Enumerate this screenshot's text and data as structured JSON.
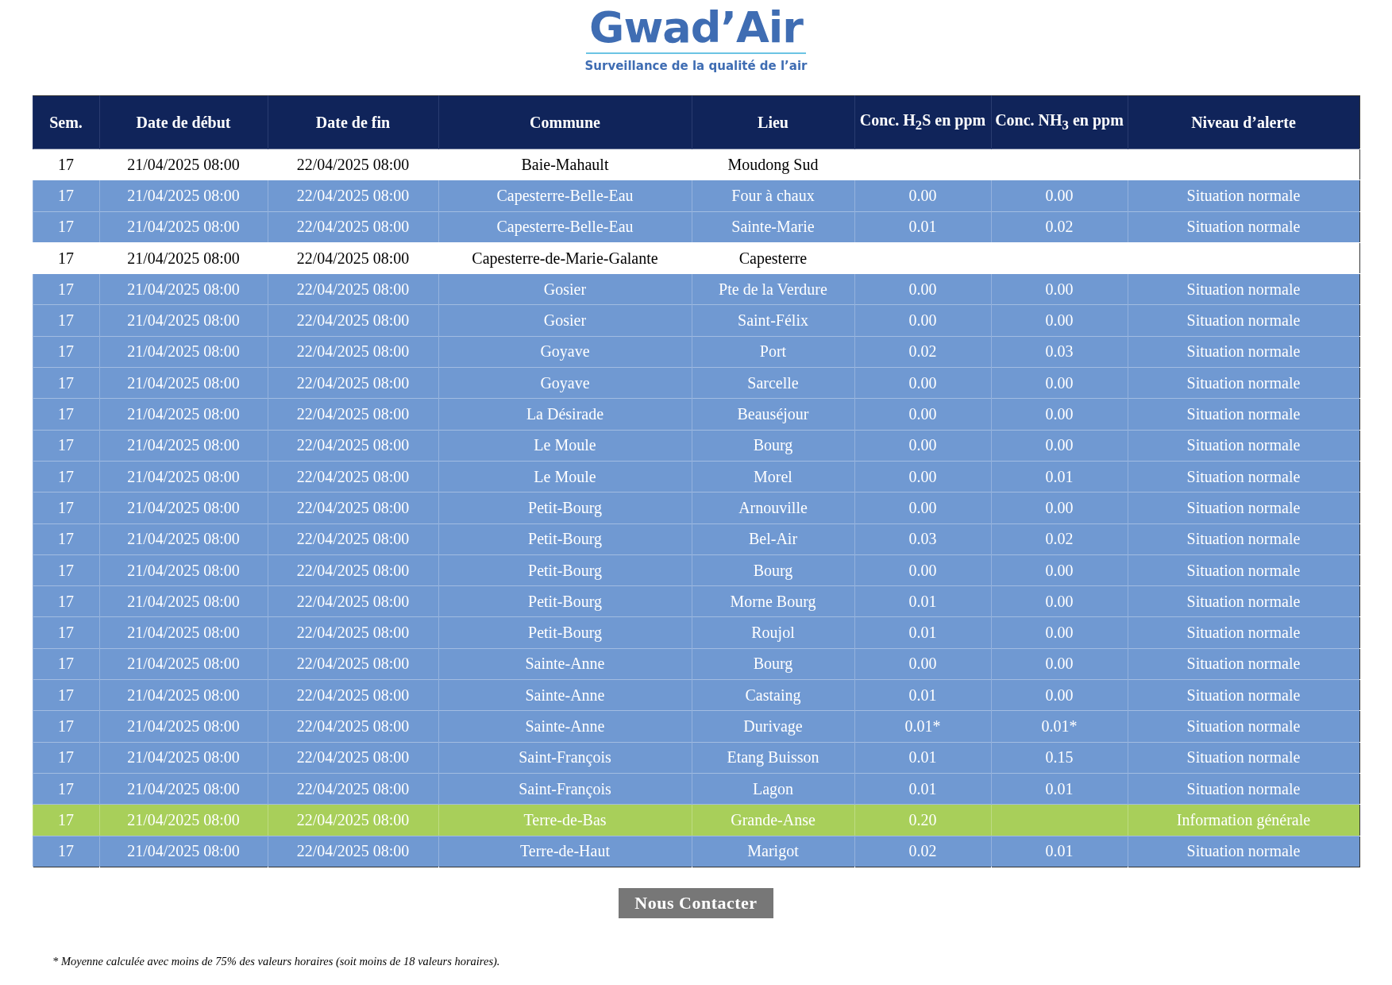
{
  "logo": {
    "name": "Gwad’Air",
    "tagline": "Surveillance de la qualité de l’air"
  },
  "table": {
    "columns": [
      "Sem.",
      "Date de début",
      "Date de fin",
      "Commune",
      "Lieu",
      "Conc. H$_{2}$S en ppm",
      "Conc. NH$_{3}$ en ppm",
      "Niveau d’alerte"
    ],
    "rows": [
      {
        "kind": "blank",
        "color": "#ffffff",
        "cells": [
          "17",
          "21/04/2025 08:00",
          "22/04/2025 08:00",
          "Baie-Mahault",
          "Moudong Sud",
          "",
          "",
          ""
        ]
      },
      {
        "kind": "normal",
        "color": "#7099d2",
        "cells": [
          "17",
          "21/04/2025 08:00",
          "22/04/2025 08:00",
          "Capesterre-Belle-Eau",
          "Four à chaux",
          "0.00",
          "0.00",
          "Situation normale"
        ]
      },
      {
        "kind": "normal",
        "color": "#7099d2",
        "cells": [
          "17",
          "21/04/2025 08:00",
          "22/04/2025 08:00",
          "Capesterre-Belle-Eau",
          "Sainte-Marie",
          "0.01",
          "0.02",
          "Situation normale"
        ]
      },
      {
        "kind": "blank",
        "color": "#ffffff",
        "cells": [
          "17",
          "21/04/2025 08:00",
          "22/04/2025 08:00",
          "Capesterre-de-Marie-Galante",
          "Capesterre",
          "",
          "",
          ""
        ]
      },
      {
        "kind": "normal",
        "color": "#7099d2",
        "cells": [
          "17",
          "21/04/2025 08:00",
          "22/04/2025 08:00",
          "Gosier",
          "Pte de la Verdure",
          "0.00",
          "0.00",
          "Situation normale"
        ]
      },
      {
        "kind": "normal",
        "color": "#7099d2",
        "cells": [
          "17",
          "21/04/2025 08:00",
          "22/04/2025 08:00",
          "Gosier",
          "Saint-Félix",
          "0.00",
          "0.00",
          "Situation normale"
        ]
      },
      {
        "kind": "normal",
        "color": "#7099d2",
        "cells": [
          "17",
          "21/04/2025 08:00",
          "22/04/2025 08:00",
          "Goyave",
          "Port",
          "0.02",
          "0.03",
          "Situation normale"
        ]
      },
      {
        "kind": "normal",
        "color": "#7099d2",
        "cells": [
          "17",
          "21/04/2025 08:00",
          "22/04/2025 08:00",
          "Goyave",
          "Sarcelle",
          "0.00",
          "0.00",
          "Situation normale"
        ]
      },
      {
        "kind": "normal",
        "color": "#7099d2",
        "cells": [
          "17",
          "21/04/2025 08:00",
          "22/04/2025 08:00",
          "La Désirade",
          "Beauséjour",
          "0.00",
          "0.00",
          "Situation normale"
        ]
      },
      {
        "kind": "normal",
        "color": "#7099d2",
        "cells": [
          "17",
          "21/04/2025 08:00",
          "22/04/2025 08:00",
          "Le Moule",
          "Bourg",
          "0.00",
          "0.00",
          "Situation normale"
        ]
      },
      {
        "kind": "normal",
        "color": "#7099d2",
        "cells": [
          "17",
          "21/04/2025 08:00",
          "22/04/2025 08:00",
          "Le Moule",
          "Morel",
          "0.00",
          "0.01",
          "Situation normale"
        ]
      },
      {
        "kind": "normal",
        "color": "#7099d2",
        "cells": [
          "17",
          "21/04/2025 08:00",
          "22/04/2025 08:00",
          "Petit-Bourg",
          "Arnouville",
          "0.00",
          "0.00",
          "Situation normale"
        ]
      },
      {
        "kind": "normal",
        "color": "#7099d2",
        "cells": [
          "17",
          "21/04/2025 08:00",
          "22/04/2025 08:00",
          "Petit-Bourg",
          "Bel-Air",
          "0.03",
          "0.02",
          "Situation normale"
        ]
      },
      {
        "kind": "normal",
        "color": "#7099d2",
        "cells": [
          "17",
          "21/04/2025 08:00",
          "22/04/2025 08:00",
          "Petit-Bourg",
          "Bourg",
          "0.00",
          "0.00",
          "Situation normale"
        ]
      },
      {
        "kind": "normal",
        "color": "#7099d2",
        "cells": [
          "17",
          "21/04/2025 08:00",
          "22/04/2025 08:00",
          "Petit-Bourg",
          "Morne Bourg",
          "0.01",
          "0.00",
          "Situation normale"
        ]
      },
      {
        "kind": "normal",
        "color": "#7099d2",
        "cells": [
          "17",
          "21/04/2025 08:00",
          "22/04/2025 08:00",
          "Petit-Bourg",
          "Roujol",
          "0.01",
          "0.00",
          "Situation normale"
        ]
      },
      {
        "kind": "normal",
        "color": "#7099d2",
        "cells": [
          "17",
          "21/04/2025 08:00",
          "22/04/2025 08:00",
          "Sainte-Anne",
          "Bourg",
          "0.00",
          "0.00",
          "Situation normale"
        ]
      },
      {
        "kind": "normal",
        "color": "#7099d2",
        "cells": [
          "17",
          "21/04/2025 08:00",
          "22/04/2025 08:00",
          "Sainte-Anne",
          "Castaing",
          "0.01",
          "0.00",
          "Situation normale"
        ]
      },
      {
        "kind": "normal",
        "color": "#7099d2",
        "cells": [
          "17",
          "21/04/2025 08:00",
          "22/04/2025 08:00",
          "Sainte-Anne",
          "Durivage",
          "0.01*",
          "0.01*",
          "Situation normale"
        ]
      },
      {
        "kind": "normal",
        "color": "#7099d2",
        "cells": [
          "17",
          "21/04/2025 08:00",
          "22/04/2025 08:00",
          "Saint-François",
          "Etang Buisson",
          "0.01",
          "0.15",
          "Situation normale"
        ]
      },
      {
        "kind": "normal",
        "color": "#7099d2",
        "cells": [
          "17",
          "21/04/2025 08:00",
          "22/04/2025 08:00",
          "Saint-François",
          "Lagon",
          "0.01",
          "0.01",
          "Situation normale"
        ]
      },
      {
        "kind": "info",
        "color": "#a8cf5a",
        "cells": [
          "17",
          "21/04/2025 08:00",
          "22/04/2025 08:00",
          "Terre-de-Bas",
          "Grande-Anse",
          "0.20",
          "",
          "Information générale"
        ]
      },
      {
        "kind": "normal",
        "color": "#7099d2",
        "cells": [
          "17",
          "21/04/2025 08:00",
          "22/04/2025 08:00",
          "Terre-de-Haut",
          "Marigot",
          "0.02",
          "0.01",
          "Situation normale"
        ]
      }
    ]
  },
  "contact_button": "Nous Contacter",
  "footnote": "* Moyenne calculée avec moins de 75% des valeurs horaires (soit moins de 18 valeurs horaires)."
}
